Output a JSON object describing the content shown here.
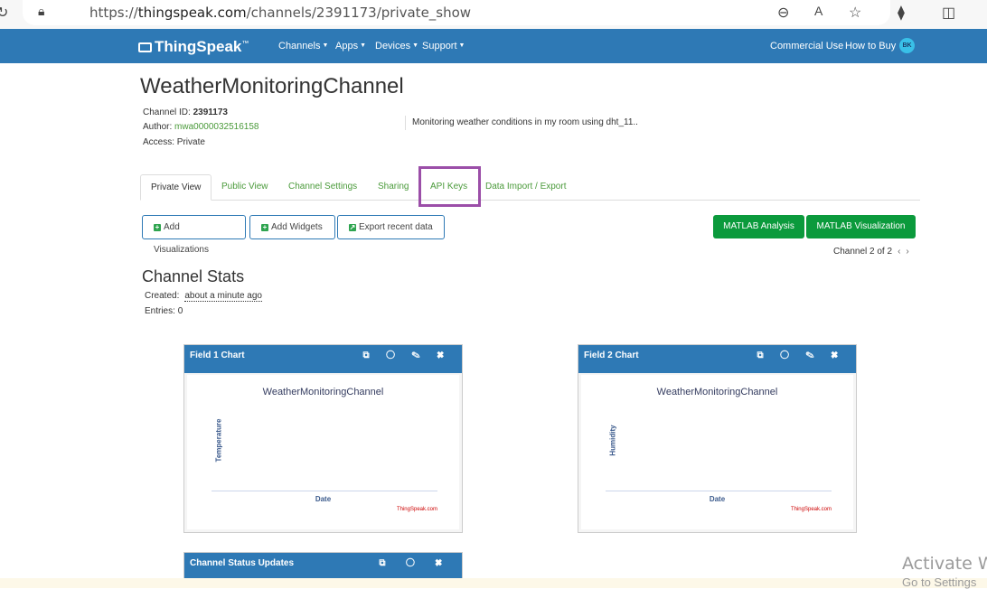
{
  "browser": {
    "url_prefix": "https://",
    "url_domain": "thingspeak.com",
    "url_path": "/channels/2391173/private_show",
    "icons": [
      "refresh-icon",
      "lock-icon",
      "zoom-out-icon",
      "read-aloud-icon",
      "favorite-star-icon",
      "extensions-icon",
      "split-screen-icon"
    ]
  },
  "nav": {
    "logo": "ThingSpeak",
    "logo_tm": "™",
    "items": [
      {
        "label": "Channels"
      },
      {
        "label": "Apps"
      },
      {
        "label": "Devices"
      },
      {
        "label": "Support"
      }
    ],
    "commercial": "Commercial Use",
    "how_to_buy": "How to Buy",
    "avatar": "BK",
    "caret": "▼"
  },
  "channel": {
    "title": "WeatherMonitoringChannel",
    "id_label": "Channel ID:",
    "id_value": "2391173",
    "author_label": "Author:",
    "author_value": "mwa0000032516158",
    "access_label": "Access:",
    "access_value": "Private",
    "description": "Monitoring weather conditions in my room using dht_11.."
  },
  "tabs": [
    {
      "label": "Private View"
    },
    {
      "label": "Public View"
    },
    {
      "label": "Channel Settings"
    },
    {
      "label": "Sharing"
    },
    {
      "label": "API Keys"
    },
    {
      "label": "Data Import / Export"
    }
  ],
  "buttons": {
    "add_visualizations": "Add Visualizations",
    "add_widgets": "Add Widgets",
    "export_recent": "Export recent data",
    "matlab_analysis": "MATLAB Analysis",
    "matlab_visualization": "MATLAB Visualization"
  },
  "pager": {
    "text": "Channel 2 of 2",
    "prev": "‹",
    "next": "›"
  },
  "stats": {
    "heading": "Channel Stats",
    "created_label": "Created:",
    "created_value": "about a minute ago",
    "entries_label": "Entries:",
    "entries_value": "0"
  },
  "panels": [
    {
      "title": "Field 1 Chart",
      "chart_title": "WeatherMonitoringChannel",
      "ylabel": "Temperature",
      "xlabel": "Date",
      "credit": "ThingSpeak.com"
    },
    {
      "title": "Field 2 Chart",
      "chart_title": "WeatherMonitoringChannel",
      "ylabel": "Humidity",
      "xlabel": "Date",
      "credit": "ThingSpeak.com"
    },
    {
      "title": "Channel Status Updates"
    }
  ],
  "panel_icons": "⧉ ◯ ✎ ✖",
  "watermark": {
    "line1": "Activate W",
    "line2": "Go to Settings"
  },
  "colors": {
    "brand": "#2e79b5",
    "green_button": "#0b9a3c",
    "link": "#4a9a3a",
    "highlight": "#9b4ea8"
  }
}
